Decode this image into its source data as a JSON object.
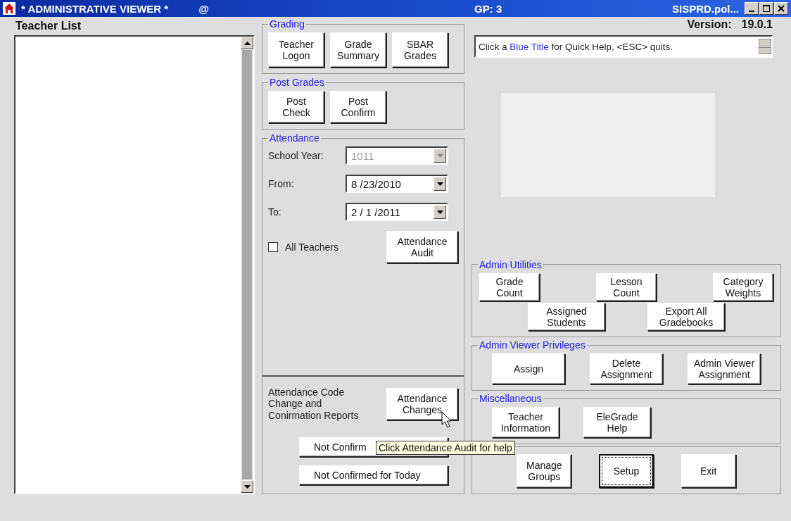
{
  "window": {
    "title": "* ADMINISTRATIVE VIEWER *",
    "at": "@",
    "gp": "GP: 3",
    "server": "SISPRD.pol..."
  },
  "teacher_list": {
    "label": "Teacher List"
  },
  "version": {
    "label": "Version:",
    "value": "19.0.1"
  },
  "grading": {
    "title": "Grading",
    "buttons": [
      {
        "label": "Teacher Logon"
      },
      {
        "label": "Grade Summary"
      },
      {
        "label": "SBAR Grades"
      }
    ]
  },
  "post_grades": {
    "title": "Post Grades",
    "buttons": [
      {
        "label": "Post Check"
      },
      {
        "label": "Post Confirm"
      }
    ]
  },
  "attendance": {
    "title": "Attendance",
    "fields": [
      {
        "label": "School Year:",
        "value": "1011",
        "disabled": true
      },
      {
        "label": "From:",
        "value": "8 /23/2010",
        "disabled": false
      },
      {
        "label": "To:",
        "value": "2 / 1 /2011",
        "disabled": false
      }
    ],
    "all_teachers": {
      "label": "All Teachers",
      "checked": false
    },
    "audit_button": "Attendance Audit",
    "reports_text": "Attendance Code Change and Conirmation Reports",
    "changes_button": "Attendance Changes",
    "report_buttons": [
      "Not Confirm",
      "Not Confirmed for Today"
    ]
  },
  "help_line": {
    "before": "Click a ",
    "highlight": "Blue Title",
    "after": " for Quick Help, <ESC> quits."
  },
  "admin_utilities": {
    "title": "Admin Utilities",
    "row_1": [
      {
        "label": "Grade Count"
      },
      {
        "label": "Lesson Count"
      },
      {
        "label": "Category Weights"
      }
    ],
    "row_2": [
      {
        "label": "Assigned Students"
      },
      {
        "label": "Export All Gradebooks"
      }
    ]
  },
  "admin_viewer_privileges": {
    "title": "Admin Viewer Privileges",
    "buttons": [
      {
        "label": "Assign"
      },
      {
        "label": "Delete Assignment"
      },
      {
        "label": "Admin Viewer Assignment"
      }
    ]
  },
  "miscellaneous": {
    "title": "Miscellaneous",
    "buttons": [
      {
        "label": "Teacher Information"
      },
      {
        "label": "EleGrade Help"
      }
    ]
  },
  "setup_group": {
    "buttons": [
      {
        "label": "Manage Groups",
        "focused": false
      },
      {
        "label": "Setup",
        "focused": true
      },
      {
        "label": "Exit",
        "focused": false
      }
    ]
  },
  "tooltip": {
    "text": "Click Attendance Audit for help"
  }
}
